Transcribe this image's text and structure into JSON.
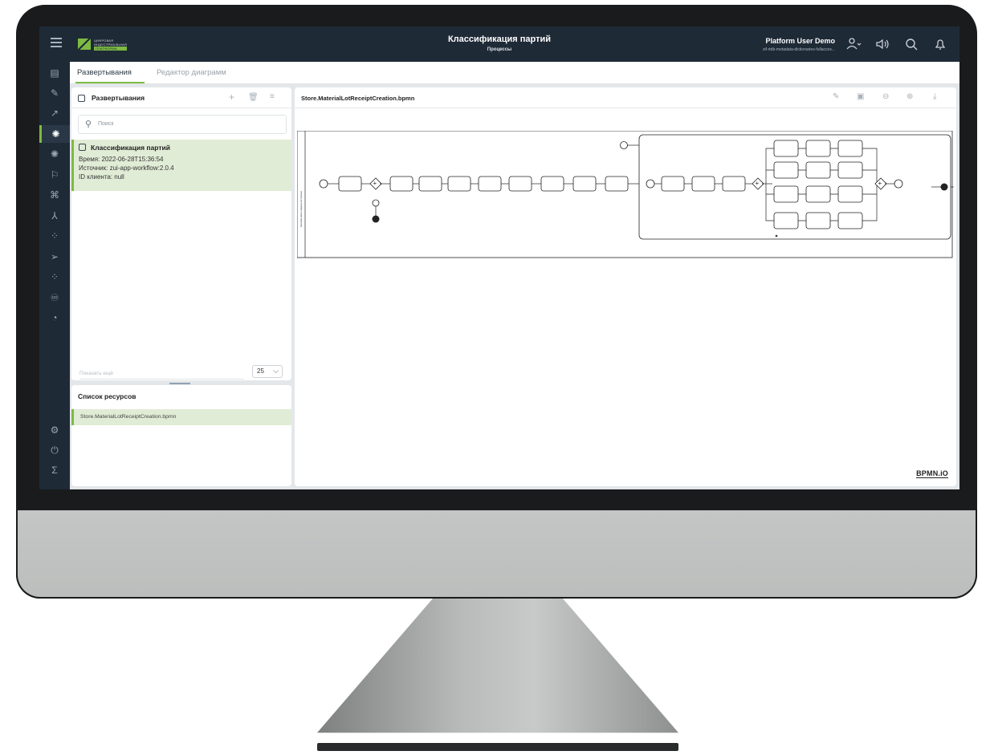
{
  "header": {
    "logo_text_lines": [
      "ЦИФРОВАЯ",
      "ИНДУСТРИАЛЬНАЯ",
      "ПЛАТФОРМА"
    ],
    "title": "Классификация партий",
    "subtitle": "Процессы",
    "user_name": "Platform User Demo",
    "user_sub": "zif-rtdb-metadata-dictionaries-fullacces..."
  },
  "tabs": [
    {
      "label": "Развертывания",
      "active": true
    },
    {
      "label": "Редактор диаграмм",
      "active": false
    }
  ],
  "deployments": {
    "title": "Развертывания",
    "search_placeholder": "Поиск",
    "item": {
      "title": "Классификация партий",
      "time": "Время: 2022-06-28T15:36:54",
      "source": "Источник: zui-app-workflow:2.0.4",
      "client": "ID клиента: null"
    },
    "show_more": "Показать ещё",
    "page_size": "25"
  },
  "resources": {
    "title": "Список ресурсов",
    "items": [
      "Store.MaterialLotReceiptCreation.bpmn"
    ]
  },
  "diagram": {
    "file_name": "Store.MaterialLotReceiptCreation.bpmn",
    "watermark": "BPMN.iO",
    "pool_label": "Массовая запись создание поступления"
  },
  "icons": {
    "menu": "menu-icon",
    "user": "user-icon",
    "sound": "sound-icon",
    "search": "search-icon",
    "bell": "bell-icon"
  },
  "colors": {
    "accent": "#7dbb42",
    "topbar": "#1f2a37",
    "selected_bg": "#e1ecd6"
  }
}
